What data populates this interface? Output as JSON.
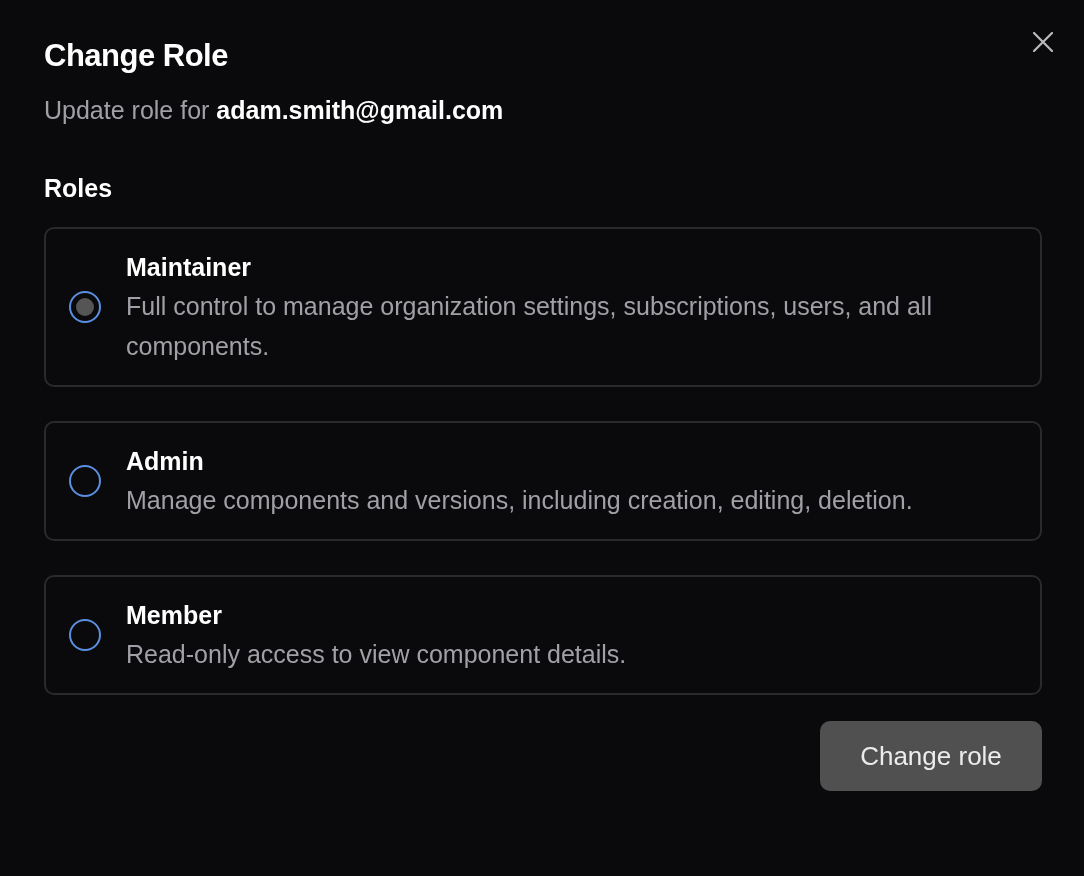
{
  "dialog": {
    "title": "Change Role",
    "subtitle": "Update role for **adam.smith@gmail.com**",
    "section_label": "Roles",
    "roles": [
      {
        "name": "Maintainer",
        "description": "Full control to manage organization settings, subscriptions, users, and all components.",
        "selected": true
      },
      {
        "name": "Admin",
        "description": "Manage components and versions, including creation, editing, deletion.",
        "selected": false
      },
      {
        "name": "Member",
        "description": "Read-only access to view component details.",
        "selected": false
      }
    ],
    "submit_button": "Change role"
  }
}
